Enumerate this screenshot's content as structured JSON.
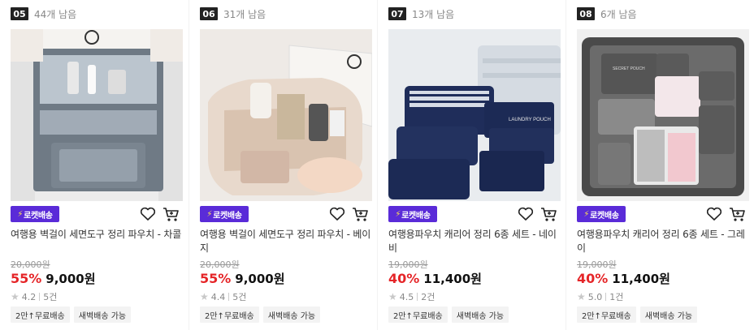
{
  "brand": {
    "rocket_badge": "로켓배송",
    "rocket_color": "#5a2bd8",
    "discount_color": "#e52528"
  },
  "products": [
    {
      "rank": "05",
      "stock": "44개 남음",
      "title": "여행용 벽걸이 세면도구 정리 파우치 - 차콜",
      "original_price": "20,000원",
      "discount": "55%",
      "price": "9,000원",
      "rating": "4.2",
      "reviews": "5건",
      "tags": [
        "2만↑무료배송",
        "새벽배송 가능"
      ],
      "image": "hanging-toiletry-pouch-charcoal"
    },
    {
      "rank": "06",
      "stock": "31개 남음",
      "title": "여행용 벽걸이 세면도구 정리 파우치 - 베이지",
      "original_price": "20,000원",
      "discount": "55%",
      "price": "9,000원",
      "rating": "4.4",
      "reviews": "5건",
      "tags": [
        "2만↑무료배송",
        "새벽배송 가능"
      ],
      "image": "hanging-toiletry-pouch-beige"
    },
    {
      "rank": "07",
      "stock": "13개 남음",
      "title": "여행용파우치 캐리어 정리 6종 세트 - 네이비",
      "original_price": "19,000원",
      "discount": "40%",
      "price": "11,400원",
      "rating": "4.5",
      "reviews": "2건",
      "tags": [
        "2만↑무료배송",
        "새벽배송 가능"
      ],
      "image": "packing-cubes-navy",
      "image_text": "LAUNDRY POUCH"
    },
    {
      "rank": "08",
      "stock": "6개 남음",
      "title": "여행용파우치 캐리어 정리 6종 세트 - 그레이",
      "original_price": "19,000원",
      "discount": "40%",
      "price": "11,400원",
      "rating": "5.0",
      "reviews": "1건",
      "tags": [
        "2만↑무료배송",
        "새벽배송 가능"
      ],
      "image": "packing-cubes-grey",
      "image_text": "SECRET POUCH"
    }
  ],
  "icons": {
    "wishlist": "heart-icon",
    "cart": "cart-icon",
    "star": "star-icon"
  }
}
